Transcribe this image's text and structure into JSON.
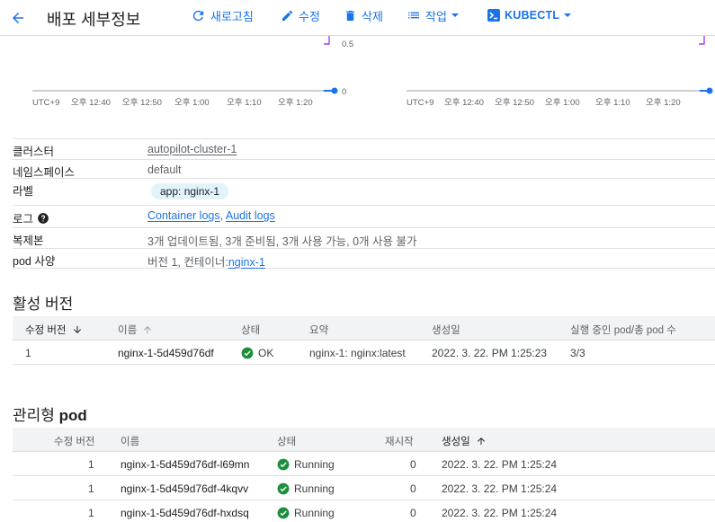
{
  "header": {
    "title": "배포 세부정보",
    "refresh": "새로고침",
    "edit": "수정",
    "delete": "삭제",
    "actions": "작업",
    "kubectl": "KUBECTL"
  },
  "charts": [
    {
      "y_ticks": [
        "0.5",
        "0"
      ],
      "x_ticks": [
        "UTC+9",
        "오후 12:40",
        "오후 12:50",
        "오후 1:00",
        "오후 1:10",
        "오후 1:20"
      ],
      "line_color": "#1a73e8",
      "marker_color": "#a142f4"
    },
    {
      "y_ticks": [],
      "x_ticks": [
        "UTC+9",
        "오후 12:40",
        "오후 12:50",
        "오후 1:00",
        "오후 1:10",
        "오후 1:20"
      ],
      "line_color": "#1a73e8",
      "marker_color": "#a142f4"
    }
  ],
  "details": {
    "cluster_label": "클러스터",
    "cluster_value": "autopilot-cluster-1",
    "namespace_label": "네임스페이스",
    "namespace_value": "default",
    "labels_label": "라벨",
    "labels_value": "app: nginx-1",
    "logs_label": "로그",
    "logs_container": "Container logs",
    "logs_sep": ", ",
    "logs_audit": "Audit logs",
    "replicas_label": "복제본",
    "replicas_value": "3개 업데이트됨, 3개 준비됨, 3개 사용 가능, 0개 사용 불가",
    "podspec_label": "pod 사양",
    "podspec_prefix": "버전 1, 컨테이너:",
    "podspec_link": "nginx-1"
  },
  "active_versions": {
    "title": "활성 버전",
    "columns": [
      "수정 버전",
      "이름",
      "상태",
      "요약",
      "생성일",
      "실행 중인 pod/총 pod 수"
    ],
    "rows": [
      {
        "revision": "1",
        "name": "nginx-1-5d459d76df",
        "status": "OK",
        "summary": "nginx-1: nginx:latest",
        "created": "2022. 3. 22. PM 1:25:23",
        "pods": "3/3"
      }
    ]
  },
  "managed_pods": {
    "title_prefix": "관리형",
    "title_bold": "pod",
    "columns": [
      "수정 버전",
      "이름",
      "상태",
      "재시작",
      "생성일"
    ],
    "rows": [
      {
        "revision": "1",
        "name": "nginx-1-5d459d76df-l69mn",
        "status": "Running",
        "restarts": "0",
        "created": "2022. 3. 22. PM 1:25:24"
      },
      {
        "revision": "1",
        "name": "nginx-1-5d459d76df-4kqvv",
        "status": "Running",
        "restarts": "0",
        "created": "2022. 3. 22. PM 1:25:24"
      },
      {
        "revision": "1",
        "name": "nginx-1-5d459d76df-hxdsq",
        "status": "Running",
        "restarts": "0",
        "created": "2022. 3. 22. PM 1:25:24"
      }
    ]
  },
  "colors": {
    "accent": "#1a73e8",
    "success": "#1e8e3e",
    "chip": "#e3f3fb"
  }
}
